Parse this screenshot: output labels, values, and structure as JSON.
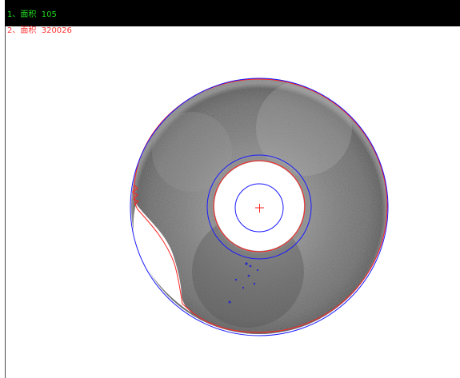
{
  "overlay": {
    "label1": "1、面积  105",
    "label2": "2、面积  320026"
  },
  "colors": {
    "label1": "#22dd22",
    "label2": "#ff3333",
    "red_contour": "#ff2222",
    "blue_circle": "#1a1aff",
    "background": "#ffffff",
    "top_strip": "#000000"
  }
}
